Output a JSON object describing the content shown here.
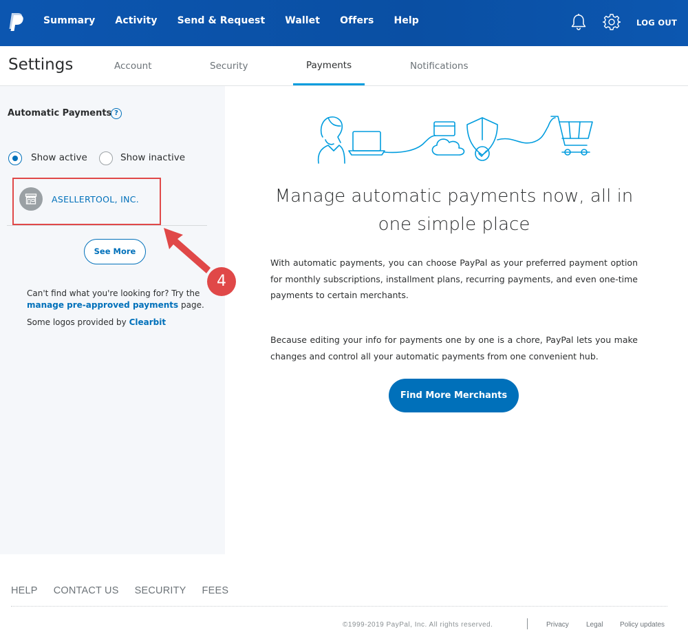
{
  "nav": {
    "items": [
      {
        "label": "Summary"
      },
      {
        "label": "Activity"
      },
      {
        "label": "Send & Request"
      },
      {
        "label": "Wallet"
      },
      {
        "label": "Offers"
      },
      {
        "label": "Help"
      }
    ],
    "logout_label": "LOG OUT",
    "brand_color": "#0c56b0"
  },
  "settings": {
    "title": "Settings",
    "tabs": [
      {
        "label": "Account"
      },
      {
        "label": "Security"
      },
      {
        "label": "Payments"
      },
      {
        "label": "Notifications"
      }
    ],
    "active_tab": "Payments"
  },
  "sidebar": {
    "heading": "Automatic Payments",
    "help_glyph": "?",
    "filters": {
      "active_label": "Show active",
      "inactive_label": "Show inactive",
      "selected": "Show active"
    },
    "merchants": [
      {
        "name": "ASELLERTOOL, INC.",
        "icon": "store-icon"
      }
    ],
    "see_more_label": "See More",
    "cant_find_prefix": "Can't find what you're looking for? Try the",
    "cant_find_link": "manage pre-approved payments",
    "cant_find_suffix": "page.",
    "logos_prefix": "Some logos provided by",
    "logos_link": "Clearbit"
  },
  "annotation": {
    "step_number": "4",
    "color": "#e04848"
  },
  "main": {
    "title": "Manage automatic payments now, all in one simple place",
    "paragraph_1": "With automatic payments, you can choose PayPal as your preferred payment option for monthly subscriptions, installment plans, recurring payments, and even one-time payments to certain merchants.",
    "paragraph_2": "Because editing your info for payments one by one is a chore, PayPal lets you make changes and control all your automatic payments from one convenient hub.",
    "button_label": "Find More Merchants",
    "accent_color": "#0070ba"
  },
  "footer": {
    "links": [
      {
        "label": "HELP"
      },
      {
        "label": "CONTACT US"
      },
      {
        "label": "SECURITY"
      },
      {
        "label": "FEES"
      }
    ],
    "copyright": "©1999-2019 PayPal, Inc. All rights reserved.",
    "legal_links": [
      {
        "label": "Privacy"
      },
      {
        "label": "Legal"
      },
      {
        "label": "Policy updates"
      }
    ]
  }
}
